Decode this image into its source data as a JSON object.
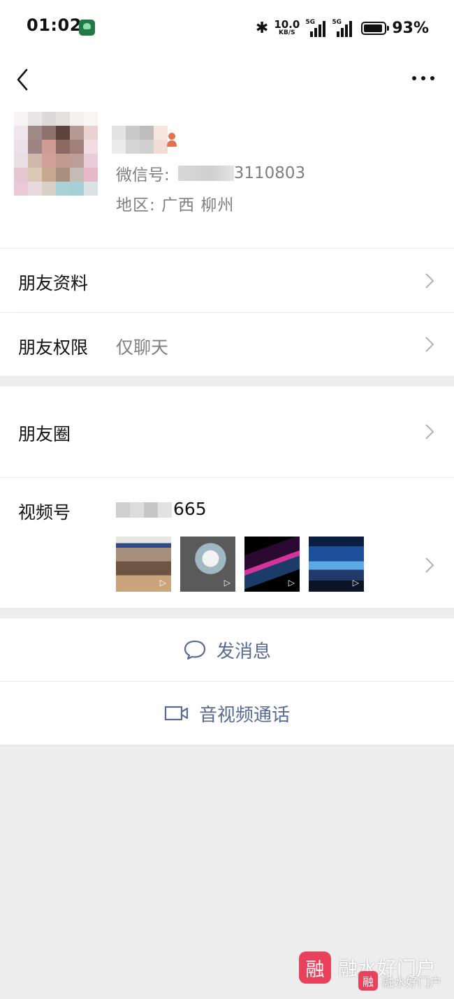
{
  "status_bar": {
    "time": "01:02",
    "bluetooth": "✱",
    "net_speed_value": "10.0",
    "net_speed_unit": "KB/S",
    "sim1_tag": "5G",
    "sim2_tag": "5G",
    "battery_level": 0.93,
    "battery_percent": "93%"
  },
  "profile": {
    "wxid_label": "微信号:",
    "wxid_visible_suffix": "3110803",
    "region_label": "地区:",
    "region_value": "广西  柳州"
  },
  "cells": {
    "friend_info": {
      "label": "朋友资料"
    },
    "friend_permission": {
      "label": "朋友权限",
      "value": "仅聊天"
    },
    "moments": {
      "label": "朋友圈"
    },
    "channels": {
      "label": "视频号",
      "value_suffix": "665"
    }
  },
  "actions": {
    "send_message": "发消息",
    "av_call": "音视频通话"
  },
  "watermark": {
    "logo_char": "融",
    "text": "融水好门户"
  },
  "colors": {
    "link_blue": "#576b95",
    "gender_female": "#e66f4d",
    "background": "#ededed"
  }
}
